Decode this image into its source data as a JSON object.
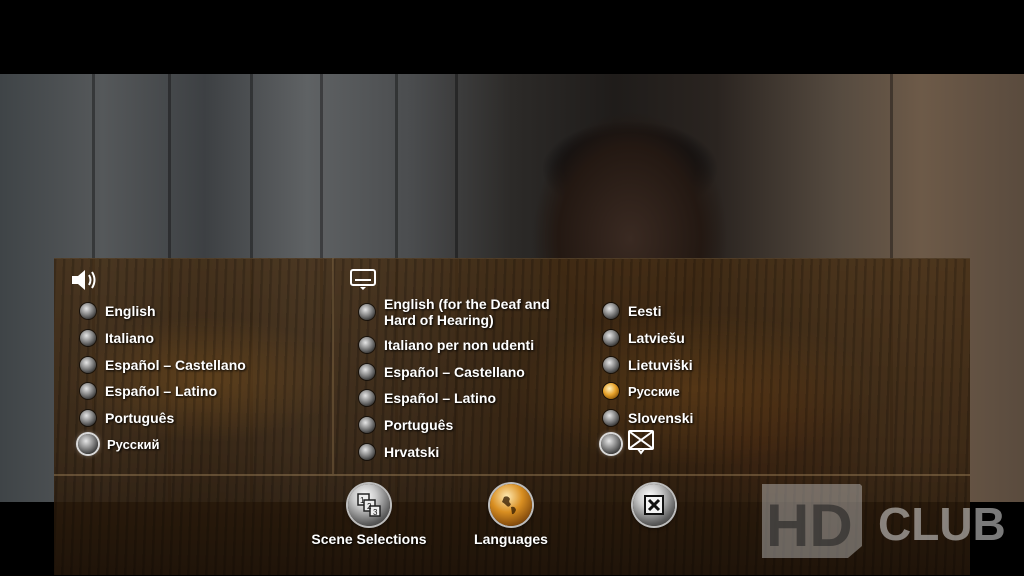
{
  "audio": {
    "icon": "speaker-icon",
    "options": [
      {
        "label": "English",
        "state": "normal"
      },
      {
        "label": "Italiano",
        "state": "normal"
      },
      {
        "label": "Español – Castellano",
        "state": "normal"
      },
      {
        "label": "Español – Latino",
        "state": "normal"
      },
      {
        "label": "Português",
        "state": "normal"
      },
      {
        "label": "Русский",
        "state": "focused"
      }
    ]
  },
  "subtitles": {
    "icon": "subtitles-screen-icon",
    "column1": [
      {
        "label": "English (for the Deaf and Hard of Hearing)",
        "state": "normal"
      },
      {
        "label": "Italiano per non udenti",
        "state": "normal"
      },
      {
        "label": "Español – Castellano",
        "state": "normal"
      },
      {
        "label": "Español – Latino",
        "state": "normal"
      },
      {
        "label": "Português",
        "state": "normal"
      },
      {
        "label": "Hrvatski",
        "state": "normal"
      }
    ],
    "column2": [
      {
        "label": "Eesti",
        "state": "normal"
      },
      {
        "label": "Latviešu",
        "state": "normal"
      },
      {
        "label": "Lietuviški",
        "state": "normal"
      },
      {
        "label": "Русские",
        "state": "selected"
      },
      {
        "label": "Slovenski",
        "state": "normal"
      },
      {
        "label": "",
        "state": "focused",
        "icon": "subtitles-off-icon"
      }
    ]
  },
  "nav": {
    "scene_selections": "Scene Selections",
    "languages": "Languages",
    "close_icon": "close-icon"
  },
  "watermark": {
    "hd": "HD",
    "club": "CLUB"
  },
  "colors": {
    "selected_radio": "#e6a12a",
    "panel": "#46301a",
    "text": "#ffffff"
  }
}
